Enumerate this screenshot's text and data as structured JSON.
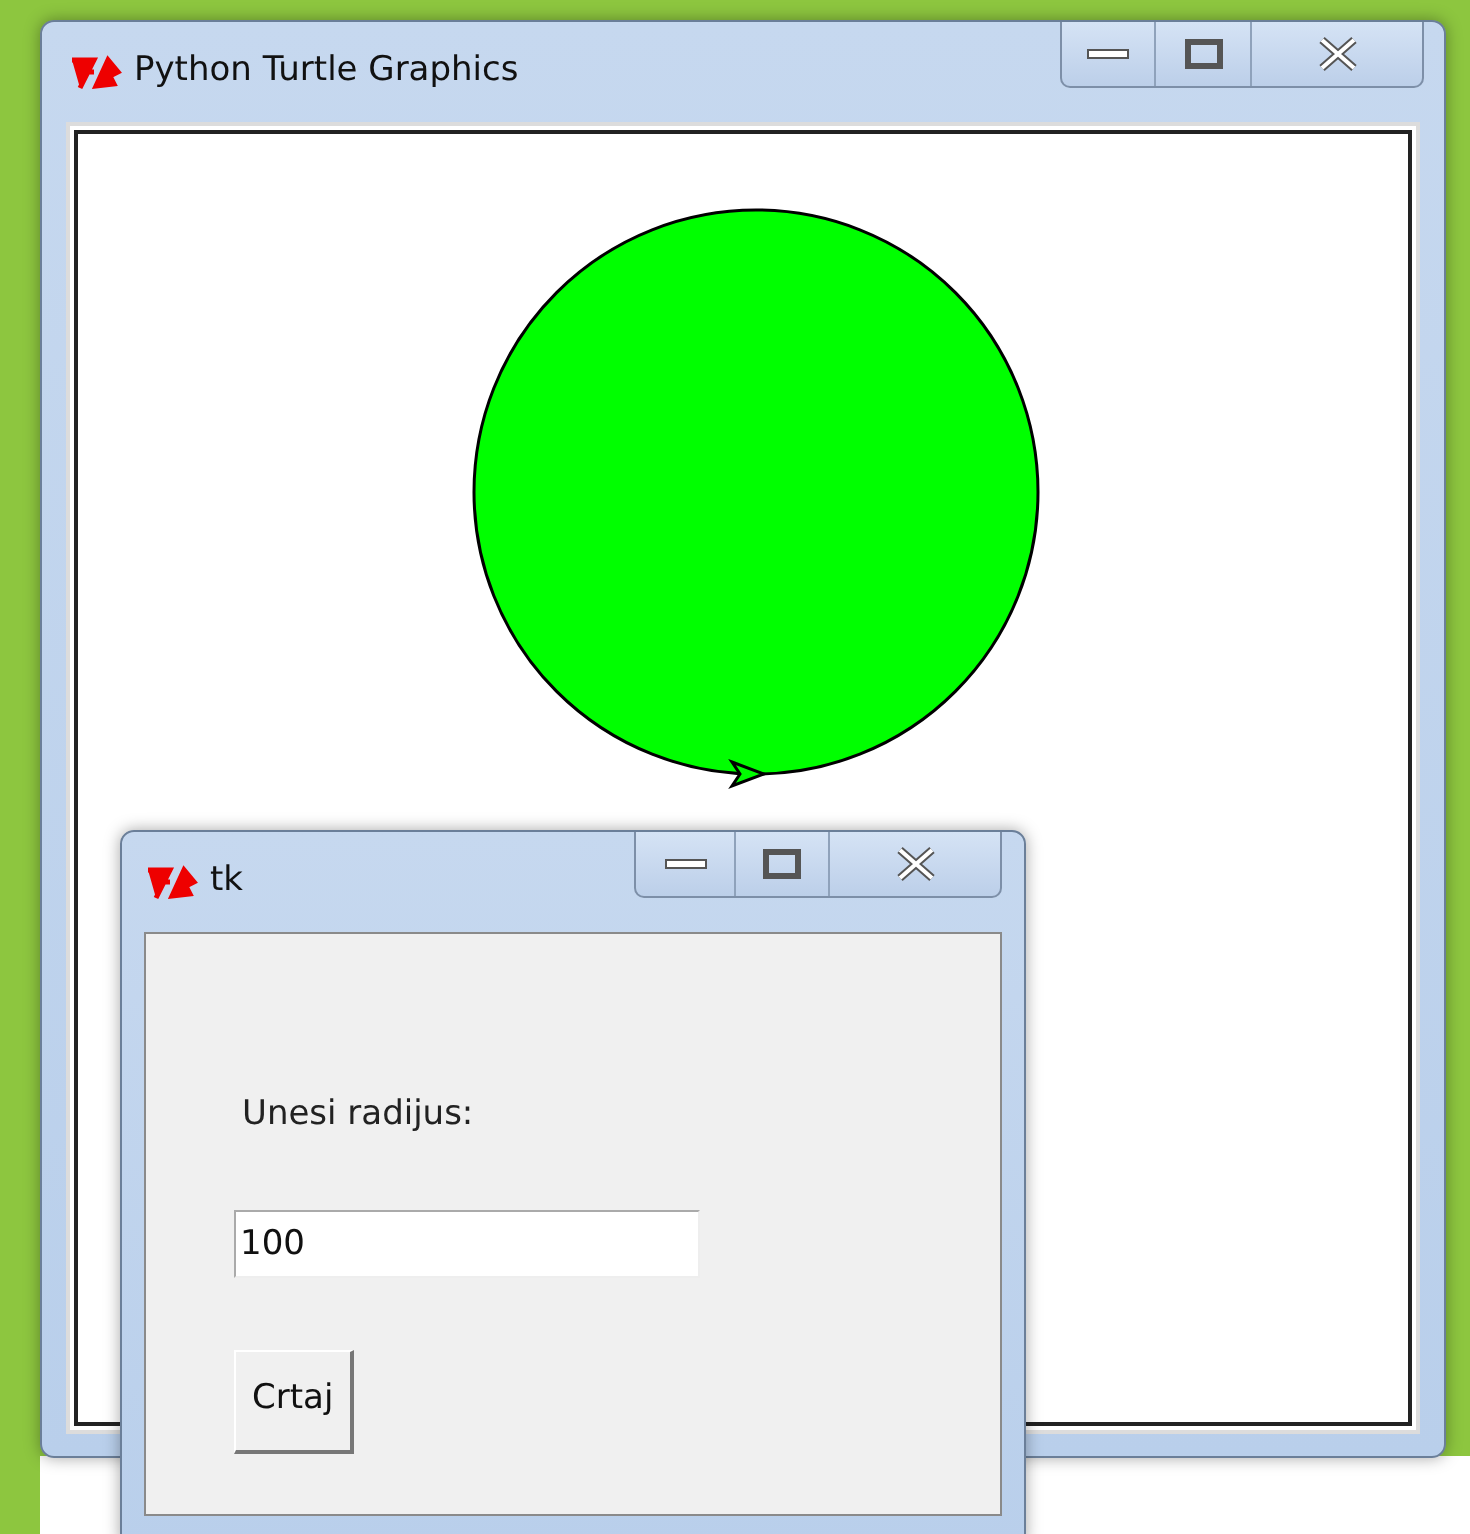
{
  "main_window": {
    "title": "Python Turtle Graphics"
  },
  "tk_window": {
    "title": "tk",
    "label": "Unesi radijus:",
    "entry": {
      "value": "100"
    },
    "button": "Crtaj"
  }
}
